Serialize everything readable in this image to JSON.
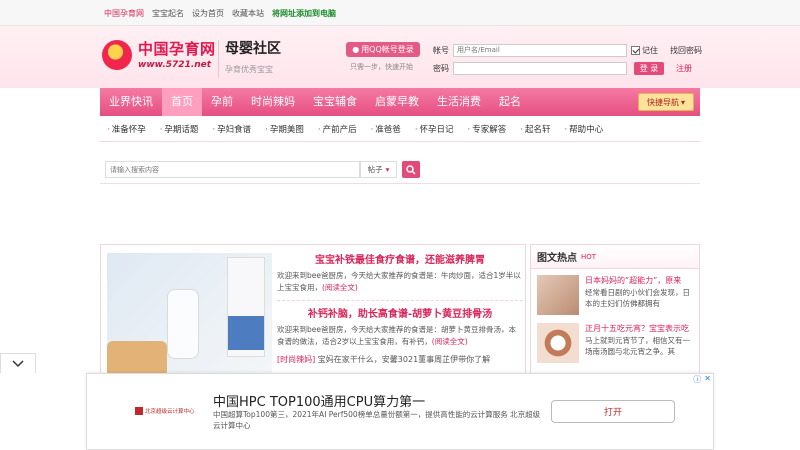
{
  "topbar": {
    "site": "中国孕育网",
    "links": [
      "宝宝起名",
      "设为首页",
      "收藏本站"
    ],
    "addfav": "将网址添加到电脑"
  },
  "logo": {
    "name": "中国孕育网",
    "url": "www.5721.net"
  },
  "community": {
    "title": "母婴社区",
    "slogan": "孕育优秀宝宝"
  },
  "qq": {
    "label": "用QQ帐号登录",
    "hint": "只需一步，快速开始"
  },
  "login": {
    "account_label": "帐号",
    "account_placeholder": "用户名/Email",
    "password_label": "密码",
    "remember": "记住",
    "forgot": "找回密码",
    "submit": "登 录",
    "register": "注册"
  },
  "nav": {
    "items": [
      "业界快讯",
      "首页",
      "孕前",
      "时尚辣妈",
      "宝宝辅食",
      "启蒙早教",
      "生活消费",
      "起名"
    ],
    "active": "首页",
    "quick": "快捷导航"
  },
  "subnav": [
    "准备怀孕",
    "孕期话题",
    "孕妇食谱",
    "孕期美图",
    "产前产后",
    "准爸爸",
    "怀孕日记",
    "专家解答",
    "起名轩",
    "帮助中心"
  ],
  "search": {
    "placeholder": "请输入搜索内容",
    "scope": "帖子"
  },
  "articles": [
    {
      "title": "宝宝补铁最佳食疗食谱，还能滋养脾胃",
      "body": "欢迎来到bee爸厨房，今天给大家推荐的食谱是：牛肉炒面，适合1岁半以上宝宝食用，",
      "more": "(阅读全文)"
    },
    {
      "title": "补钙补脑，助长高食谱-胡萝卜黄豆排骨汤",
      "body": "欢迎来到bee爸厨房，今天给大家推荐的食谱是：胡萝卜黄豆排骨汤，本食谱的做法，适合2岁以上宝宝食用，有补钙，",
      "more": "(阅读全文)"
    }
  ],
  "listline": {
    "tag": "[时尚辣妈]",
    "text": "宝妈在家干什么，安馨3021董事周芷伊带你了解"
  },
  "hot": {
    "title": "图文热点",
    "badge": "HOT",
    "items": [
      {
        "title": "日本妈妈的“超能力”，原来",
        "desc": "经常看日剧的小伙们会发现，日本的主妇们仿佛都拥有"
      },
      {
        "title": "正月十五吃元宵？宝宝表示吃",
        "desc": "马上就到元宵节了，相信又有一场南汤圆与北元宵之争。其"
      }
    ]
  },
  "ad": {
    "advertiser": "北京超级云计算中心",
    "headline": "中国HPC TOP100通用CPU算力第一",
    "body": "中国超算Top100第三，2021年AI Perf500榜单总量份额第一，提供高性能的云计算服务 北京超级云计算中心",
    "cta": "打开"
  }
}
